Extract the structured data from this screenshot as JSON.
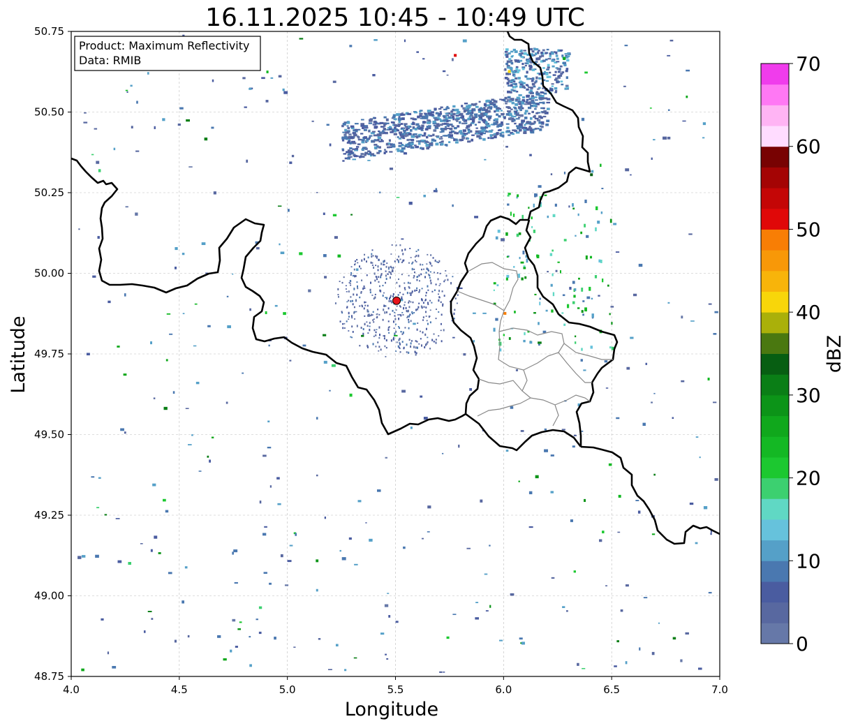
{
  "title": "16.11.2025 10:45 - 10:49 UTC",
  "info_box": {
    "product": "Product: Maximum Reflectivity",
    "data": "Data: RMIB"
  },
  "axes": {
    "xlabel": "Longitude",
    "ylabel": "Latitude",
    "xlim": [
      4.0,
      7.0
    ],
    "ylim": [
      48.75,
      50.75
    ],
    "xticks": [
      "4.0",
      "4.5",
      "5.0",
      "5.5",
      "6.0",
      "6.5",
      "7.0"
    ],
    "yticks": [
      "48.75",
      "49.00",
      "49.25",
      "49.50",
      "49.75",
      "50.00",
      "50.25",
      "50.50",
      "50.75"
    ],
    "grid": true
  },
  "radar_site": {
    "lon": 5.505,
    "lat": 49.915,
    "color": "#e8141c"
  },
  "colorbar": {
    "label": "dBZ",
    "min": 0,
    "max": 70,
    "step": 2.5,
    "tick_labels": [
      "0",
      "10",
      "20",
      "30",
      "40",
      "50",
      "60",
      "70"
    ],
    "colors": [
      "#6678a8",
      "#5868a0",
      "#4a5ca0",
      "#4a78b0",
      "#55a0c8",
      "#66c2dc",
      "#60d8c4",
      "#3cd070",
      "#1cc830",
      "#14b824",
      "#10a81c",
      "#0c9418",
      "#0a7e16",
      "#075e12",
      "#4a7810",
      "#aab00a",
      "#f8d60a",
      "#f8b40a",
      "#f89808",
      "#f87e05",
      "#e00808",
      "#c40606",
      "#a40404",
      "#780202",
      "#ffdcff",
      "#ffb4f4",
      "#ff78f4",
      "#f03cec"
    ]
  },
  "chart_data": {
    "type": "heatmap",
    "title": "16.11.2025 10:45 - 10:49 UTC",
    "xlabel": "Longitude",
    "ylabel": "Latitude",
    "xlim": [
      4.0,
      7.0
    ],
    "ylim": [
      48.75,
      50.75
    ],
    "value_label": "dBZ",
    "value_range": [
      0,
      70
    ],
    "echo_regions": [
      {
        "lon": [
          5.25,
          6.2
        ],
        "lat": [
          50.37,
          50.54
        ],
        "dbz_typ": 5
      },
      {
        "lon": [
          6.0,
          6.3
        ],
        "lat": [
          50.56,
          50.7
        ],
        "dbz_typ": 6
      },
      {
        "lon": [
          5.4,
          5.62
        ],
        "lat": [
          49.85,
          50.0
        ],
        "dbz_typ": 4
      },
      {
        "lon": [
          6.0,
          6.15
        ],
        "lat": [
          49.8,
          49.95
        ],
        "dbz_typ": 20
      }
    ]
  }
}
